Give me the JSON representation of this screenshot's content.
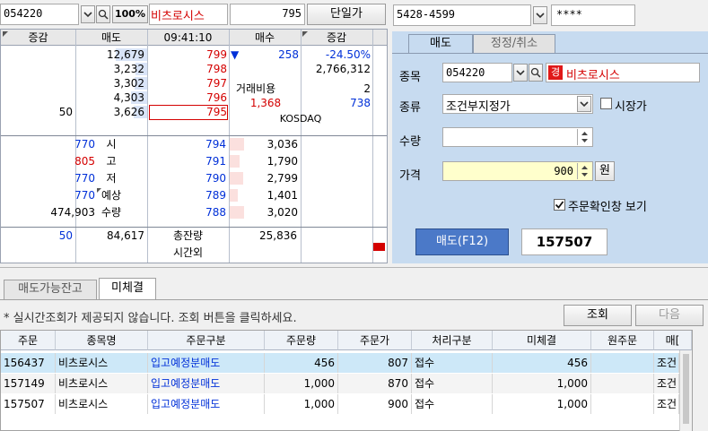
{
  "toolbar": {
    "stock_code": "054220",
    "percent_btn": "100%",
    "stock_name": "비츠로시스",
    "price": "795",
    "unit_price_btn": "단일가"
  },
  "account": {
    "number": "5428-4599",
    "password": "****"
  },
  "orderbook": {
    "headers": [
      "증감",
      "매도",
      "09:41:10",
      "매수",
      "증감"
    ],
    "asks": [
      {
        "change": "",
        "qty": "12,679",
        "price": "799"
      },
      {
        "change": "",
        "qty": "3,232",
        "price": "798"
      },
      {
        "change": "",
        "qty": "3,302",
        "price": "797"
      },
      {
        "change": "",
        "qty": "4,303",
        "price": "796"
      },
      {
        "change": "50",
        "qty": "3,626",
        "price": "795"
      }
    ],
    "bids": [
      {
        "price": "794",
        "qty": "3,036"
      },
      {
        "price": "791",
        "qty": "1,790"
      },
      {
        "price": "790",
        "qty": "2,799"
      },
      {
        "price": "789",
        "qty": "1,401"
      },
      {
        "price": "788",
        "qty": "3,020"
      }
    ],
    "info": {
      "down_arrow": "▼",
      "diff": "258",
      "rate": "-24.50%",
      "volume": "2,766,312",
      "fee_label": "거래비용",
      "fee_value": "2",
      "low_val": "1,368",
      "right_val": "738",
      "market": "KOSDAQ"
    },
    "stats": [
      {
        "value": "770",
        "label": "시"
      },
      {
        "value": "805",
        "label": "고"
      },
      {
        "value": "770",
        "label": "저"
      },
      {
        "value": "770",
        "label": "예상"
      },
      {
        "value": "474,903",
        "label": "수량"
      }
    ],
    "totals": {
      "ask_change": "50",
      "ask_total": "84,617",
      "label": "총잔량",
      "bid_total": "25,836",
      "after_hours": "시간외"
    }
  },
  "order_form": {
    "tabs": [
      "매도",
      "정정/취소"
    ],
    "stock_label": "종목",
    "stock_code": "054220",
    "stock_badge": "경",
    "stock_name": "비츠로시스",
    "type_label": "종류",
    "type_value": "조건부지정가",
    "market_price_label": "시장가",
    "qty_label": "수량",
    "qty_value": "",
    "price_label": "가격",
    "price_value": "900",
    "won_btn": "원",
    "confirm_label": "주문확인창 보기",
    "sell_btn": "매도(F12)",
    "order_no": "157507"
  },
  "bottom": {
    "tabs": [
      "매도가능잔고",
      "미체결"
    ],
    "notice": "* 실시간조회가 제공되지 않습니다. 조회 버튼을 클릭하세요.",
    "query_btn": "조회",
    "next_btn": "다음",
    "columns": [
      "주문",
      "종목명",
      "주문구분",
      "주문량",
      "주문가",
      "처리구분",
      "미체결",
      "원주문",
      "매["
    ],
    "rows": [
      {
        "order": "156437",
        "name": "비츠로시스",
        "type": "입고예정분매도",
        "qty": "456",
        "price": "807",
        "status": "접수",
        "unfilled": "456",
        "orig": "",
        "cond": "조건"
      },
      {
        "order": "157149",
        "name": "비츠로시스",
        "type": "입고예정분매도",
        "qty": "1,000",
        "price": "870",
        "status": "접수",
        "unfilled": "1,000",
        "orig": "",
        "cond": "조건"
      },
      {
        "order": "157507",
        "name": "비츠로시스",
        "type": "입고예정분매도",
        "qty": "1,000",
        "price": "900",
        "status": "접수",
        "unfilled": "1,000",
        "orig": "",
        "cond": "조건"
      }
    ]
  },
  "colors": {
    "ask_bar": "#d9e4f7",
    "bid_bar": "#fbe0de",
    "selected_row": "#cde8f8",
    "sell_button": "#4b79c8",
    "panel_bg": "#c7dbf0"
  }
}
